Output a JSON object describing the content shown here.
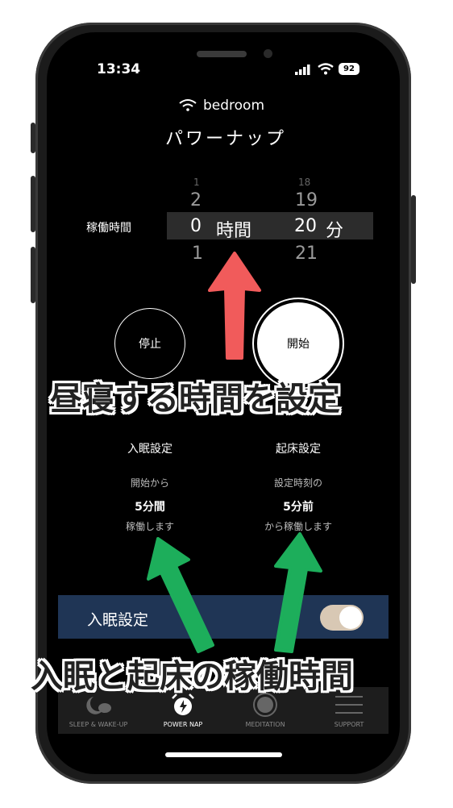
{
  "status_bar": {
    "time": "13:34",
    "battery": "92"
  },
  "header": {
    "network_name": "bedroom",
    "title": "パワーナップ"
  },
  "picker": {
    "label": "稼働時間",
    "hour_above_far": "1",
    "hour_above": "2",
    "hour_value": "0",
    "hour_unit": "時間",
    "hour_below": "1",
    "minute_above_far": "18",
    "minute_above": "19",
    "minute_value": "20",
    "minute_unit": "分",
    "minute_below": "21"
  },
  "buttons": {
    "stop": "停止",
    "start": "開始"
  },
  "annotations": {
    "top": "昼寝する時間を設定",
    "bottom": "入眠と起床の稼働時間",
    "arrow_red": "#f15b5b",
    "arrow_green": "#1dae5b"
  },
  "sleep_settings": {
    "heading": "入眠設定",
    "line1": "開始から",
    "line2": "5分間",
    "line3": "稼働します"
  },
  "wake_settings": {
    "heading": "起床設定",
    "line1": "設定時刻の",
    "line2": "5分前",
    "line3": "から稼働します"
  },
  "toggle_bar": {
    "label": "入眠設定",
    "enabled": true,
    "bar_color": "#1f3555"
  },
  "tabs": [
    {
      "label": "SLEEP & WAKE-UP",
      "icon": "moon-cloud-icon"
    },
    {
      "label": "POWER NAP",
      "icon": "alarm-clock-icon",
      "active": true
    },
    {
      "label": "MEDITATION",
      "icon": "meditation-circle-icon"
    },
    {
      "label": "SUPPORT",
      "icon": "menu-lines-icon"
    }
  ]
}
